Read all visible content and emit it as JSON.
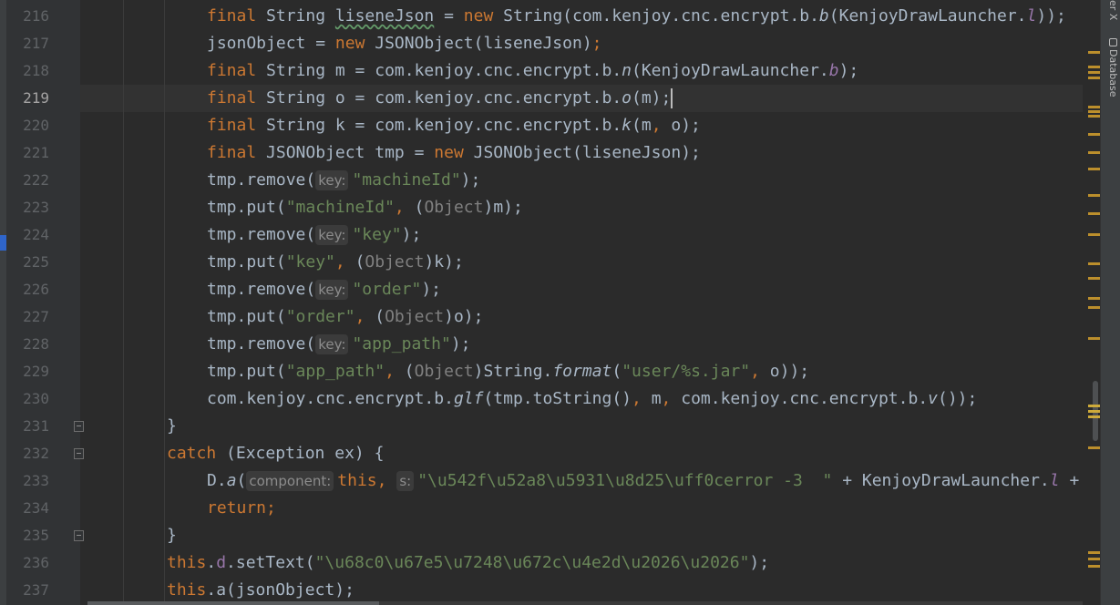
{
  "colors": {
    "background": "#2b2b2b",
    "gutter": "#313335",
    "keyword": "#cc7832",
    "string": "#6a8759",
    "field": "#9876aa",
    "text": "#a9b7c6",
    "line_number": "#606366",
    "marker": "#bc8f2c"
  },
  "right_panel": {
    "tab_clipped": "er X",
    "tab_database": "Database",
    "tab_database_icon": "database-icon"
  },
  "editor": {
    "current_line": 219,
    "line_numbers": [
      "216",
      "217",
      "218",
      "219",
      "220",
      "221",
      "222",
      "223",
      "224",
      "225",
      "226",
      "227",
      "228",
      "229",
      "230",
      "231",
      "232",
      "233",
      "234",
      "235",
      "236",
      "237"
    ],
    "hints": {
      "key": "key:",
      "component": "component:",
      "s": "s:"
    },
    "code": {
      "l216": {
        "kw": "final",
        "t1": " String ",
        "var": "liseneJson",
        "t2": " = ",
        "kw2": "new",
        "t3": " String(com.kenjoy.cnc.encrypt.b.",
        "m": "b",
        "t4": "(KenjoyDrawLauncher.",
        "f": "l",
        "t5": "));"
      },
      "l217": {
        "t1": "jsonObject = ",
        "kw": "new",
        "t2": " JSONObject(liseneJson)",
        "semi": ";"
      },
      "l218": {
        "kw": "final",
        "t1": " String m = com.kenjoy.cnc.encrypt.b.",
        "m": "n",
        "t2": "(KenjoyDrawLauncher.",
        "f": "b",
        "t3": ");"
      },
      "l219": {
        "kw": "final",
        "t1": " String o = com.kenjoy.cnc.encrypt.b.",
        "m": "o",
        "t2": "(m);"
      },
      "l220": {
        "kw": "final",
        "t1": " String k = com.kenjoy.cnc.encrypt.b.",
        "m": "k",
        "t2": "(m",
        "comma": ",",
        "t3": " o);"
      },
      "l221": {
        "kw": "final",
        "t1": " JSONObject tmp = ",
        "kw2": "new",
        "t2": " JSONObject(liseneJson);"
      },
      "l222": {
        "t1": "tmp.remove(",
        "s": "\"machineId\"",
        "t2": ");"
      },
      "l223": {
        "t1": "tmp.put(",
        "s": "\"machineId\"",
        "comma": ",",
        "t2": " (",
        "c": "Object",
        "t3": ")m);"
      },
      "l224": {
        "t1": "tmp.remove(",
        "s": "\"key\"",
        "t2": ");"
      },
      "l225": {
        "t1": "tmp.put(",
        "s": "\"key\"",
        "comma": ",",
        "t2": " (",
        "c": "Object",
        "t3": ")k);"
      },
      "l226": {
        "t1": "tmp.remove(",
        "s": "\"order\"",
        "t2": ");"
      },
      "l227": {
        "t1": "tmp.put(",
        "s": "\"order\"",
        "comma": ",",
        "t2": " (",
        "c": "Object",
        "t3": ")o);"
      },
      "l228": {
        "t1": "tmp.remove(",
        "s": "\"app_path\"",
        "t2": ");"
      },
      "l229": {
        "t1": "tmp.put(",
        "s": "\"app_path\"",
        "comma": ",",
        "t2": " (",
        "c": "Object",
        "t3": ")String.",
        "m": "format",
        "t4": "(",
        "s2": "\"user/%s.jar\"",
        "comma2": ",",
        "t5": " o));"
      },
      "l230": {
        "t1": "com.kenjoy.cnc.encrypt.b.",
        "m": "glf",
        "t2": "(tmp.toString()",
        "comma": ",",
        "t3": " m",
        "comma2": ",",
        "t4": " com.kenjoy.cnc.encrypt.b.",
        "m2": "v",
        "t5": "());"
      },
      "l231": {
        "t1": "}"
      },
      "l232": {
        "kw": "catch",
        "t1": " (Exception ex) {"
      },
      "l233": {
        "t1": "D.",
        "m": "a",
        "t2": "(",
        "kw": "this,",
        "s": "\"\\u542f\\u52a8\\u5931\\u8d25\\uff0cerror -3  \"",
        "t3": " + KenjoyDrawLauncher.",
        "f": "l",
        "t4": " +"
      },
      "l234": {
        "kw": "return",
        "t1": ";"
      },
      "l235": {
        "t1": "}"
      },
      "l236": {
        "kw": "this",
        "t1": ".",
        "f": "d",
        "t2": ".setText(",
        "s": "\"\\u68c0\\u67e5\\u7248\\u672c\\u4e2d\\u2026\\u2026\"",
        "t3": ");"
      },
      "l237": {
        "kw": "this",
        "t1": ".a(jsonObject);"
      }
    }
  }
}
